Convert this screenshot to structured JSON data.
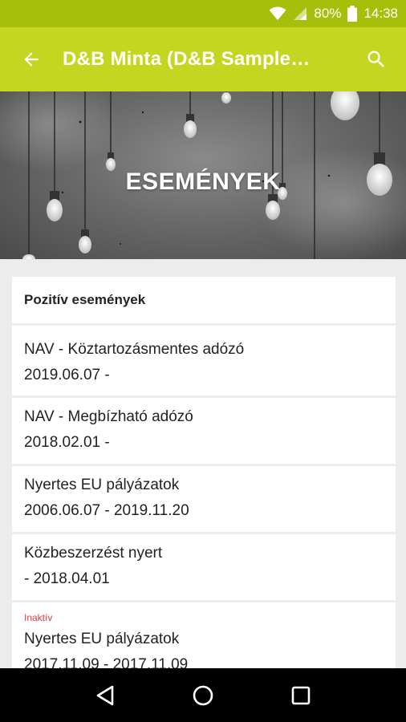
{
  "status_bar": {
    "battery_percent": "80%",
    "time": "14:38",
    "icons": [
      "wifi-icon",
      "signal-icon",
      "battery-icon"
    ]
  },
  "app_bar": {
    "title": "D&B Minta (D&B Sample…",
    "back_icon": "arrow-left-icon",
    "search_icon": "search-icon",
    "background_color": "#c4d620"
  },
  "hero": {
    "title": "ESEMÉNYEK"
  },
  "events": {
    "section_title": "Pozitív események",
    "items": [
      {
        "name": "NAV - Köztartozásmentes adózó",
        "date": "2019.06.07 -"
      },
      {
        "name": "NAV - Megbízható adózó",
        "date": "2018.02.01 -"
      },
      {
        "name": "Nyertes EU pályázatok",
        "date": "2006.06.07 - 2019.11.20"
      },
      {
        "name": "Közbeszerzést nyert",
        "date": "- 2018.04.01"
      },
      {
        "badge": "Inaktív",
        "name": "Nyertes EU pályázatok",
        "date": "2017.11.09 - 2017.11.09"
      }
    ]
  },
  "nav_bar": {
    "icons": [
      "back-triangle-icon",
      "home-circle-icon",
      "recents-square-icon"
    ]
  }
}
